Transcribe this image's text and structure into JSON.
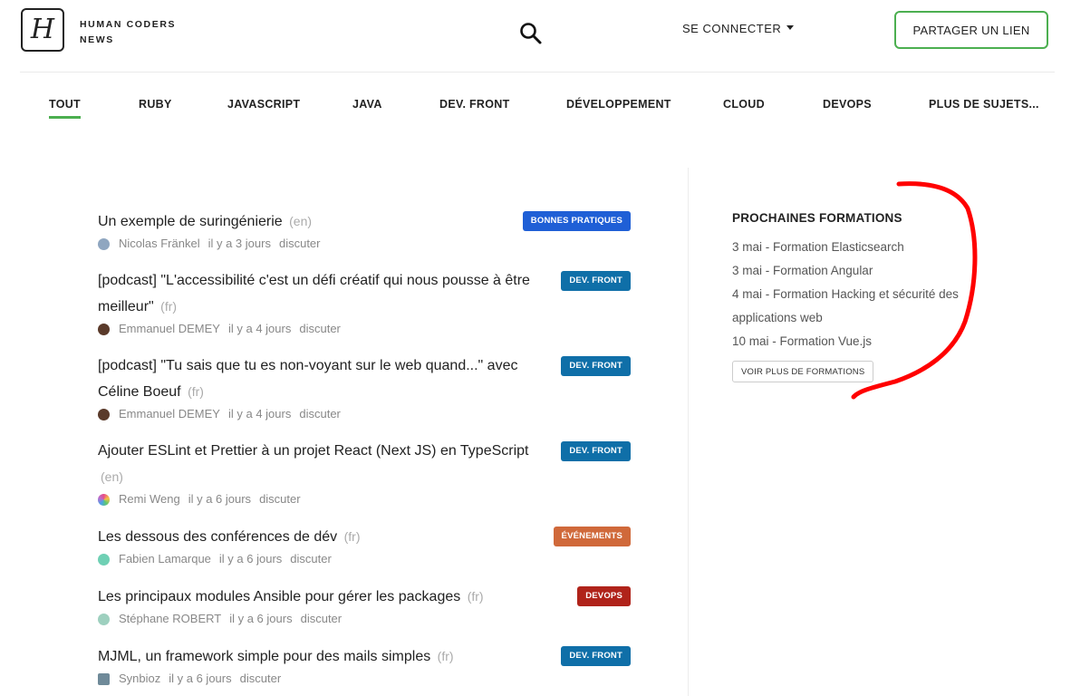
{
  "header": {
    "logo_letter": "H",
    "brand_line1": "HUMAN CODERS",
    "brand_line2": "NEWS",
    "login_label": "SE CONNECTER",
    "share_label": "PARTAGER UN LIEN"
  },
  "tabs": [
    {
      "label": "TOUT",
      "active": true
    },
    {
      "label": "RUBY"
    },
    {
      "label": "JAVASCRIPT"
    },
    {
      "label": "JAVA"
    },
    {
      "label": "DEV. FRONT"
    },
    {
      "label": "DÉVELOPPEMENT"
    },
    {
      "label": "CLOUD"
    },
    {
      "label": "DEVOPS"
    },
    {
      "label": "PLUS DE SUJETS..."
    }
  ],
  "feed": [
    {
      "title": "Un exemple de suringénierie",
      "lang": "(en)",
      "author": "Nicolas Fränkel",
      "time": "il y a 3 jours",
      "discuss": "discuter",
      "tag": "BONNES PRATIQUES",
      "tag_color": "#1f5fd6",
      "avatar_color": "#8fa6c0"
    },
    {
      "title": "[podcast] \"L'accessibilité c'est un défi créatif qui nous pousse à être meilleur\"",
      "lang": "(fr)",
      "author": "Emmanuel DEMEY",
      "time": "il y a 4 jours",
      "discuss": "discuter",
      "tag": "DEV. FRONT",
      "tag_color": "#0f6fa8",
      "avatar_color": "#5a3a2a"
    },
    {
      "title": "[podcast] \"Tu sais que tu es non-voyant sur le web quand...\" avec Céline Boeuf",
      "lang": "(fr)",
      "author": "Emmanuel DEMEY",
      "time": "il y a 4 jours",
      "discuss": "discuter",
      "tag": "DEV. FRONT",
      "tag_color": "#0f6fa8",
      "avatar_color": "#5a3a2a"
    },
    {
      "title": "Ajouter ESLint et Prettier à un projet React (Next JS) en TypeScript",
      "lang": "(en)",
      "author": "Remi Weng",
      "time": "il y a 6 jours",
      "discuss": "discuter",
      "tag": "DEV. FRONT",
      "tag_color": "#0f6fa8",
      "avatar_color": "#c46fd0"
    },
    {
      "title": "Les dessous des conférences de dév",
      "lang": "(fr)",
      "author": "Fabien Lamarque",
      "time": "il y a 6 jours",
      "discuss": "discuter",
      "tag": "ÉVÉNEMENTS",
      "tag_color": "#d0693a",
      "avatar_color": "#6fd0b4"
    },
    {
      "title": "Les principaux modules Ansible pour gérer les packages",
      "lang": "(fr)",
      "author": "Stéphane ROBERT",
      "time": "il y a 6 jours",
      "discuss": "discuter",
      "tag": "DEVOPS",
      "tag_color": "#b0231a",
      "avatar_color": "#9ed0bf"
    },
    {
      "title": "MJML, un framework simple pour des mails simples",
      "lang": "(fr)",
      "author": "Synbioz",
      "time": "il y a 6 jours",
      "discuss": "discuter",
      "tag": "DEV. FRONT",
      "tag_color": "#0f6fa8",
      "avatar_color": "#6f8a99"
    }
  ],
  "sidebar": {
    "title": "PROCHAINES FORMATIONS",
    "items": [
      "3 mai - Formation Elasticsearch",
      "3 mai - Formation Angular",
      "4 mai - Formation Hacking et sécurité des applications web",
      "10 mai - Formation Vue.js"
    ],
    "more_label": "VOIR PLUS DE FORMATIONS"
  },
  "colors": {
    "accent": "#4caf50",
    "annotation": "#ff0000"
  },
  "icons": {
    "search": "search-icon",
    "caret": "chevron-down-icon"
  }
}
